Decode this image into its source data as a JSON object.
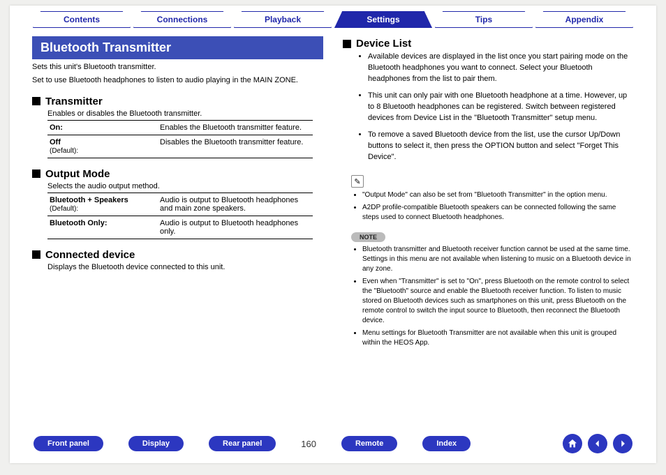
{
  "tabs": {
    "items": [
      "Contents",
      "Connections",
      "Playback",
      "Settings",
      "Tips",
      "Appendix"
    ],
    "active_index": 3
  },
  "left": {
    "title": "Bluetooth Transmitter",
    "intro1": "Sets this unit's Bluetooth transmitter.",
    "intro2": "Set to use Bluetooth headphones to listen to audio playing in the MAIN ZONE.",
    "transmitter": {
      "heading": "Transmitter",
      "desc": "Enables or disables the Bluetooth transmitter.",
      "rows": [
        {
          "term": "On:",
          "default": "",
          "desc": "Enables the Bluetooth transmitter feature."
        },
        {
          "term": "Off",
          "default": "(Default):",
          "desc": "Disables the Bluetooth transmitter feature."
        }
      ]
    },
    "output": {
      "heading": "Output Mode",
      "desc": "Selects the audio output method.",
      "rows": [
        {
          "term": "Bluetooth + Speakers",
          "default": "(Default):",
          "desc": "Audio is output to Bluetooth headphones and main zone speakers."
        },
        {
          "term": "Bluetooth Only:",
          "default": "",
          "desc": "Audio is output to Bluetooth headphones only."
        }
      ]
    },
    "connected": {
      "heading": "Connected device",
      "desc": "Displays the Bluetooth device connected to this unit."
    }
  },
  "right": {
    "device_list": {
      "heading": "Device List",
      "bullets": [
        "Available devices are displayed in the list once you start pairing mode on the Bluetooth headphones you want to connect. Select your Bluetooth headphones from the list to pair them.",
        "This unit can only pair with one Bluetooth headphone at a time. However, up to 8 Bluetooth headphones can be registered. Switch between registered devices from Device List in the \"Bluetooth Transmitter\" setup menu.",
        "To remove a saved Bluetooth device from the list, use the cursor Up/Down buttons to select it, then press the OPTION button and select \"Forget This Device\"."
      ]
    },
    "tips": [
      "\"Output Mode\" can also be set from \"Bluetooth Transmitter\" in the option menu.",
      "A2DP profile-compatible Bluetooth speakers can be connected following the same steps used to connect Bluetooth headphones."
    ],
    "note_label": "NOTE",
    "notes": [
      "Bluetooth transmitter and Bluetooth receiver function cannot be used at the same time. Settings in this menu are not available when listening to music on a Bluetooth device in any zone.",
      "Even when \"Transmitter\" is set to \"On\", press Bluetooth on the remote control to select the \"Bluetooth\" source and enable the Bluetooth receiver function. To listen to music stored on Bluetooth devices such as smartphones on this unit, press Bluetooth on the remote control to switch the input source to Bluetooth, then reconnect the Bluetooth device.",
      "Menu settings for Bluetooth Transmitter are not available when this unit is grouped within the HEOS App."
    ]
  },
  "footer": {
    "pills": [
      "Front panel",
      "Display",
      "Rear panel"
    ],
    "page": "160",
    "pills2": [
      "Remote",
      "Index"
    ]
  }
}
